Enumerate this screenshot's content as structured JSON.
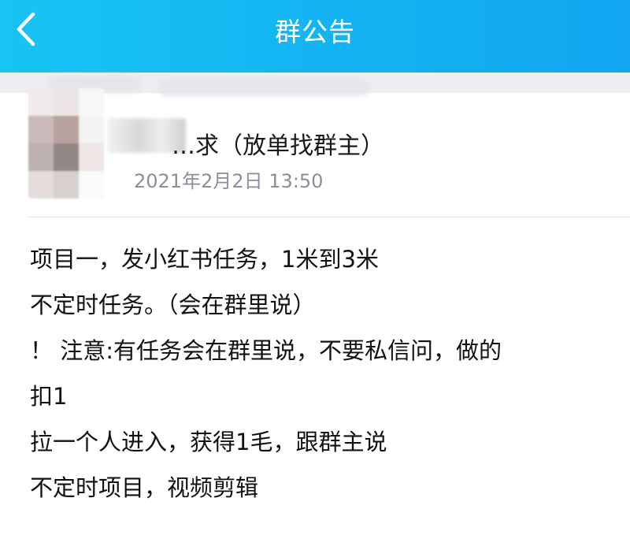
{
  "header": {
    "title": "群公告",
    "back_icon": "chevron-left-icon",
    "background": "#14b4f2"
  },
  "post": {
    "poster_name": "…求（放单找群主）",
    "time": "2021年2月2日 13:50"
  },
  "content": {
    "lines": [
      "项目一，发小红书任务，1米到3米",
      "不定时任务。（会在群里说）",
      "！ 注意:有任务会在群里说，不要私信问，做的",
      "扣1",
      "拉一个人进入，获得1毛，跟群主说",
      "不定时项目，视频剪辑"
    ]
  }
}
